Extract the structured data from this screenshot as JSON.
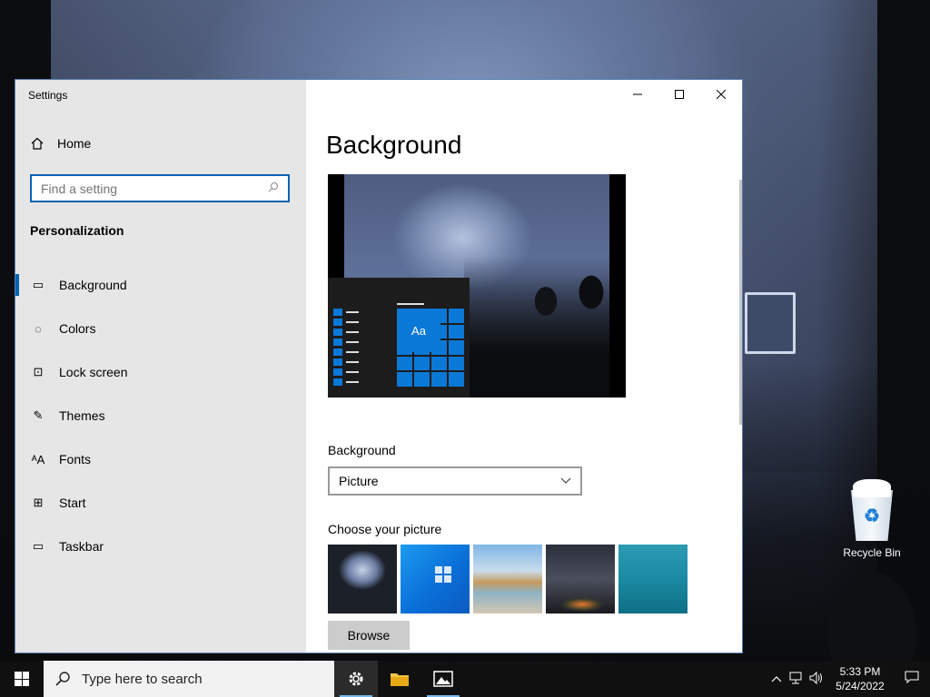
{
  "window": {
    "title": "Settings",
    "home_label": "Home",
    "search_placeholder": "Find a setting",
    "section_title": "Personalization",
    "nav": [
      {
        "label": "Background",
        "icon": "picture-icon",
        "glyph": "▭",
        "active": true
      },
      {
        "label": "Colors",
        "icon": "palette-icon",
        "glyph": "◌",
        "active": false
      },
      {
        "label": "Lock screen",
        "icon": "lock-screen-icon",
        "glyph": "⊡",
        "active": false
      },
      {
        "label": "Themes",
        "icon": "themes-icon",
        "glyph": "✎",
        "active": false
      },
      {
        "label": "Fonts",
        "icon": "fonts-icon",
        "glyph": "ᴬA",
        "active": false
      },
      {
        "label": "Start",
        "icon": "start-icon",
        "glyph": "⊞",
        "active": false
      },
      {
        "label": "Taskbar",
        "icon": "taskbar-icon",
        "glyph": "▭",
        "active": false
      }
    ]
  },
  "main": {
    "title": "Background",
    "preview_tile_text": "Aa",
    "background_label": "Background",
    "background_value": "Picture",
    "choose_label": "Choose your picture",
    "browse_label": "Browse"
  },
  "desktop": {
    "recycle_bin_label": "Recycle Bin"
  },
  "taskbar": {
    "search_placeholder": "Type here to search",
    "time": "5:33 PM",
    "date": "5/24/2022"
  },
  "colors": {
    "accent": "#0063b1",
    "taskbar": "#101010",
    "sidebar": "#e6e6e6"
  }
}
